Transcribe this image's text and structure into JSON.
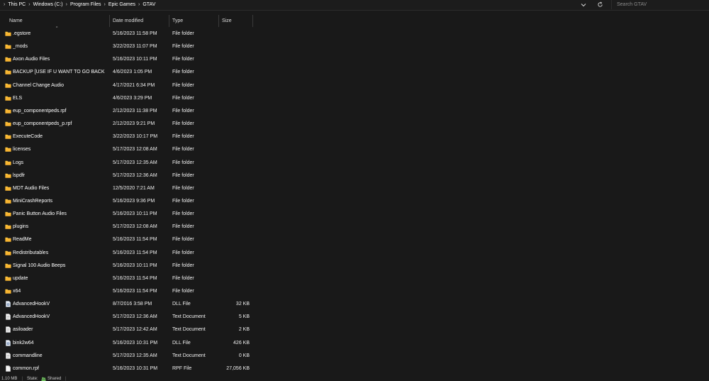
{
  "breadcrumb": {
    "items": [
      "This PC",
      "Windows (C:)",
      "Program Files",
      "Epic Games",
      "GTAV"
    ]
  },
  "search": {
    "placeholder": "Search GTAV"
  },
  "columns": {
    "name": "Name",
    "date": "Date modified",
    "type": "Type",
    "size": "Size"
  },
  "files": [
    {
      "name": ".egstore",
      "date": "5/16/2023 11:58 PM",
      "type": "File folder",
      "size": "",
      "icon": "folder-icon"
    },
    {
      "name": "_mods",
      "date": "3/22/2023 11:07 PM",
      "type": "File folder",
      "size": "",
      "icon": "folder-icon"
    },
    {
      "name": "Axon Audio Files",
      "date": "5/16/2023 10:11 PM",
      "type": "File folder",
      "size": "",
      "icon": "folder-icon"
    },
    {
      "name": "BACKUP [USE IF U WANT TO GO BACK T...",
      "date": "4/6/2023 1:05 PM",
      "type": "File folder",
      "size": "",
      "icon": "folder-icon"
    },
    {
      "name": "Channel Change Audio",
      "date": "4/17/2021 6:34 PM",
      "type": "File folder",
      "size": "",
      "icon": "folder-icon"
    },
    {
      "name": "ELS",
      "date": "4/6/2023 3:29 PM",
      "type": "File folder",
      "size": "",
      "icon": "folder-icon"
    },
    {
      "name": "eup_componentpeds.rpf",
      "date": "2/12/2023 11:38 PM",
      "type": "File folder",
      "size": "",
      "icon": "folder-icon"
    },
    {
      "name": "eup_componentpeds_p.rpf",
      "date": "2/12/2023 9:21 PM",
      "type": "File folder",
      "size": "",
      "icon": "folder-icon"
    },
    {
      "name": "ExecuteCode",
      "date": "3/22/2023 10:17 PM",
      "type": "File folder",
      "size": "",
      "icon": "folder-icon"
    },
    {
      "name": "licenses",
      "date": "5/17/2023 12:08 AM",
      "type": "File folder",
      "size": "",
      "icon": "folder-icon"
    },
    {
      "name": "Logs",
      "date": "5/17/2023 12:35 AM",
      "type": "File folder",
      "size": "",
      "icon": "folder-icon"
    },
    {
      "name": "lspdfr",
      "date": "5/17/2023 12:36 AM",
      "type": "File folder",
      "size": "",
      "icon": "folder-icon"
    },
    {
      "name": "MDT Audio Files",
      "date": "12/5/2020 7:21 AM",
      "type": "File folder",
      "size": "",
      "icon": "folder-icon"
    },
    {
      "name": "MiniCrashReports",
      "date": "5/16/2023 9:36 PM",
      "type": "File folder",
      "size": "",
      "icon": "folder-icon"
    },
    {
      "name": "Panic Button Audio Files",
      "date": "5/16/2023 10:11 PM",
      "type": "File folder",
      "size": "",
      "icon": "folder-icon"
    },
    {
      "name": "plugins",
      "date": "5/17/2023 12:08 AM",
      "type": "File folder",
      "size": "",
      "icon": "folder-icon"
    },
    {
      "name": "ReadMe",
      "date": "5/16/2023 11:54 PM",
      "type": "File folder",
      "size": "",
      "icon": "folder-icon"
    },
    {
      "name": "Redistributables",
      "date": "5/16/2023 11:54 PM",
      "type": "File folder",
      "size": "",
      "icon": "folder-icon"
    },
    {
      "name": "Signal 100 Audio Beeps",
      "date": "5/16/2023 10:11 PM",
      "type": "File folder",
      "size": "",
      "icon": "folder-icon"
    },
    {
      "name": "update",
      "date": "5/16/2023 11:54 PM",
      "type": "File folder",
      "size": "",
      "icon": "folder-icon"
    },
    {
      "name": "x64",
      "date": "5/16/2023 11:54 PM",
      "type": "File folder",
      "size": "",
      "icon": "folder-icon"
    },
    {
      "name": "AdvancedHookV",
      "date": "8/7/2016 3:58 PM",
      "type": "DLL File",
      "size": "32 KB",
      "icon": "dll-file-icon"
    },
    {
      "name": "AdvancedHookV",
      "date": "5/17/2023 12:36 AM",
      "type": "Text Document",
      "size": "5 KB",
      "icon": "text-file-icon"
    },
    {
      "name": "asiloader",
      "date": "5/17/2023 12:42 AM",
      "type": "Text Document",
      "size": "2 KB",
      "icon": "text-file-icon"
    },
    {
      "name": "bink2w64",
      "date": "5/16/2023 10:31 PM",
      "type": "DLL File",
      "size": "426 KB",
      "icon": "dll-file-icon"
    },
    {
      "name": "commandline",
      "date": "5/17/2023 12:35 AM",
      "type": "Text Document",
      "size": "0 KB",
      "icon": "text-file-icon"
    },
    {
      "name": "common.rpf",
      "date": "5/16/2023 10:31 PM",
      "type": "RPF File",
      "size": "27,056 KB",
      "icon": "generic-file-icon"
    }
  ],
  "status": {
    "size_text": "1.10 MB",
    "state_label": "State:",
    "state_value": "Shared"
  },
  "colors": {
    "folder": "#ffc83d",
    "background": "#191919",
    "text": "#ffffff"
  }
}
